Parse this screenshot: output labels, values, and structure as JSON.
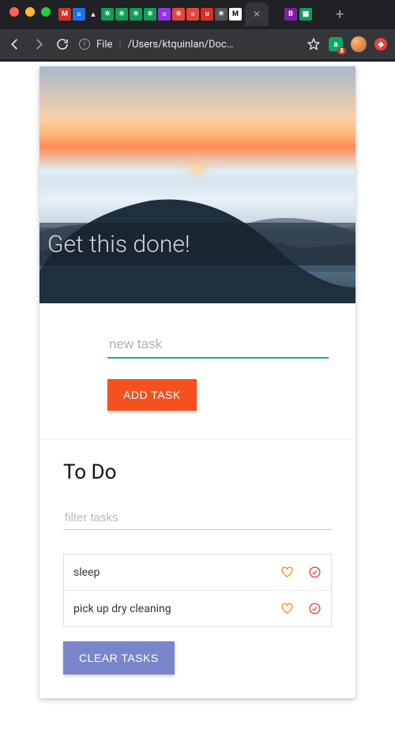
{
  "browser": {
    "url_scheme": "File",
    "url_path": "/Users/ktquinlan/Doc…",
    "ext_badge_letter": "a",
    "ext_badge_count": "8"
  },
  "hero": {
    "title": "Get this done!"
  },
  "add": {
    "placeholder": "new task",
    "value": "",
    "button": "ADD TASK"
  },
  "list": {
    "heading": "To Do",
    "filter_placeholder": "filter tasks",
    "clear_button": "CLEAR TASKS",
    "tasks": [
      {
        "text": "sleep"
      },
      {
        "text": "pick up dry cleaning"
      }
    ]
  },
  "icons": {
    "heart": "heart-icon",
    "check": "check-circle-icon"
  },
  "favicons": [
    "M",
    "≡",
    "🔥",
    "✳",
    "✳",
    "✳",
    "✳",
    "≡",
    "✳",
    "≡",
    "u",
    "✳",
    "M"
  ]
}
